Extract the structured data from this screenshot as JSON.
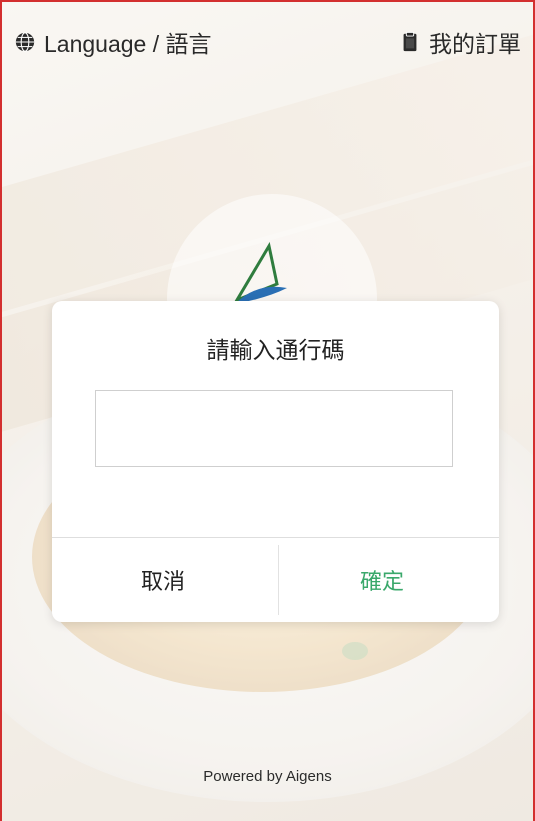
{
  "topbar": {
    "language_label": "Language / 語言",
    "orders_label": "我的訂單",
    "language_icon": "globe-icon",
    "orders_icon": "clipboard-icon"
  },
  "dialog": {
    "title": "請輸入通行碼",
    "input_value": "",
    "cancel_label": "取消",
    "confirm_label": "確定"
  },
  "footer": {
    "powered_by": "Powered by Aigens"
  },
  "colors": {
    "confirm": "#3aa86b",
    "frame_border": "#d32f2f"
  }
}
